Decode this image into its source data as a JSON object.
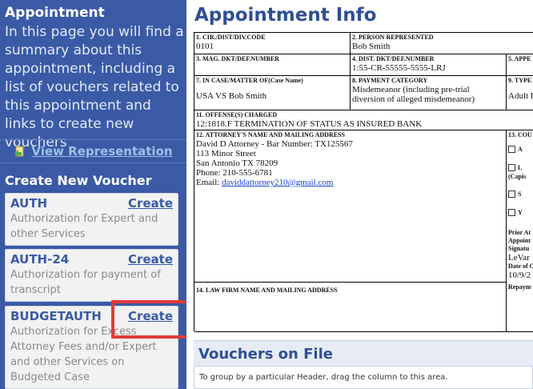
{
  "sidebar": {
    "title": "Appointment",
    "description": "In this page you will find a summary about this appointment, including a list of vouchers related to this appointment and links to create new vouchers",
    "view_representation": "View Representation",
    "create_voucher_title": "Create New Voucher",
    "vouchers": [
      {
        "name": "AUTH",
        "create": "Create",
        "description": "Authorization for Expert and other Services"
      },
      {
        "name": "AUTH-24",
        "create": "Create",
        "description": "Authorization for payment of transcript"
      },
      {
        "name": "BUDGETAUTH",
        "create": "Create",
        "description": "Authorization for Excess Attorney Fees and/or Expert and other Services on Budgeted Case"
      }
    ]
  },
  "main": {
    "title": "Appointment Info",
    "form": {
      "f1_label": "1. CIR./DIST/DIV.CODE",
      "f1_value": "0101",
      "f2_label": "2. PERSON REPRESENTED",
      "f2_value": "Bob Smith",
      "f3_label": "3. MAG. DKT/DEF.NUMBER",
      "f3_value": "",
      "f4_label": "4. DIST. DKT/DEF.NUMBER",
      "f4_value": "1:55-CR-55555-5555-LRJ",
      "f5_label": "5. APPE",
      "f7_label": "7. IN CASE/MATTER OF(Case Name)",
      "f7_value": "USA VS Bob Smith",
      "f8_label": "8. PAYMENT CATEGORY",
      "f8_value": "Misdemeanor (including pre-trial diversion of alleged misdemeanor)",
      "f9_label": "9. TYPE",
      "f9_value": "Adult I",
      "f11_label": "11. OFFENSE(S) CHARGED",
      "f11_value": "12:1818.F TERMINATION OF STATUS AS INSURED BANK",
      "f12_label": "12. ATTORNEY'S NAME AND MAILING ADDRESS",
      "f12_lines": [
        "David D Attorney - Bar Number: TX125567",
        "113 Minor Street",
        "San Antonio TX 78209",
        "Phone: 210-555-6781"
      ],
      "f12_email_prefix": "Email: ",
      "f12_email": "daviddattorney210@gmail.com",
      "f13_label": "13. COU",
      "f13_options": [
        "A",
        "L",
        "S",
        "Y"
      ],
      "f13_capis": "(Capis",
      "f13_prior": "Prior At",
      "f13_appoint": "Appoint",
      "f13_signature": "Signatu",
      "f13_signer": "LeVar",
      "f13_date_label": "Date of O",
      "f13_date": "10/9/2",
      "f13_repay": "Repaym",
      "f14_label": "14. LAW FIRM NAME AND MAILING ADDRESS"
    },
    "vouchers_on_file_title": "Vouchers on File",
    "group_bar_text": "To group by a particular Header, drag the column to this area."
  },
  "colors": {
    "sidebar_bg": "#3a5aa6",
    "title_blue": "#2f4f95",
    "highlight_red": "#e03a3a",
    "link_light": "#9cc0e8"
  }
}
